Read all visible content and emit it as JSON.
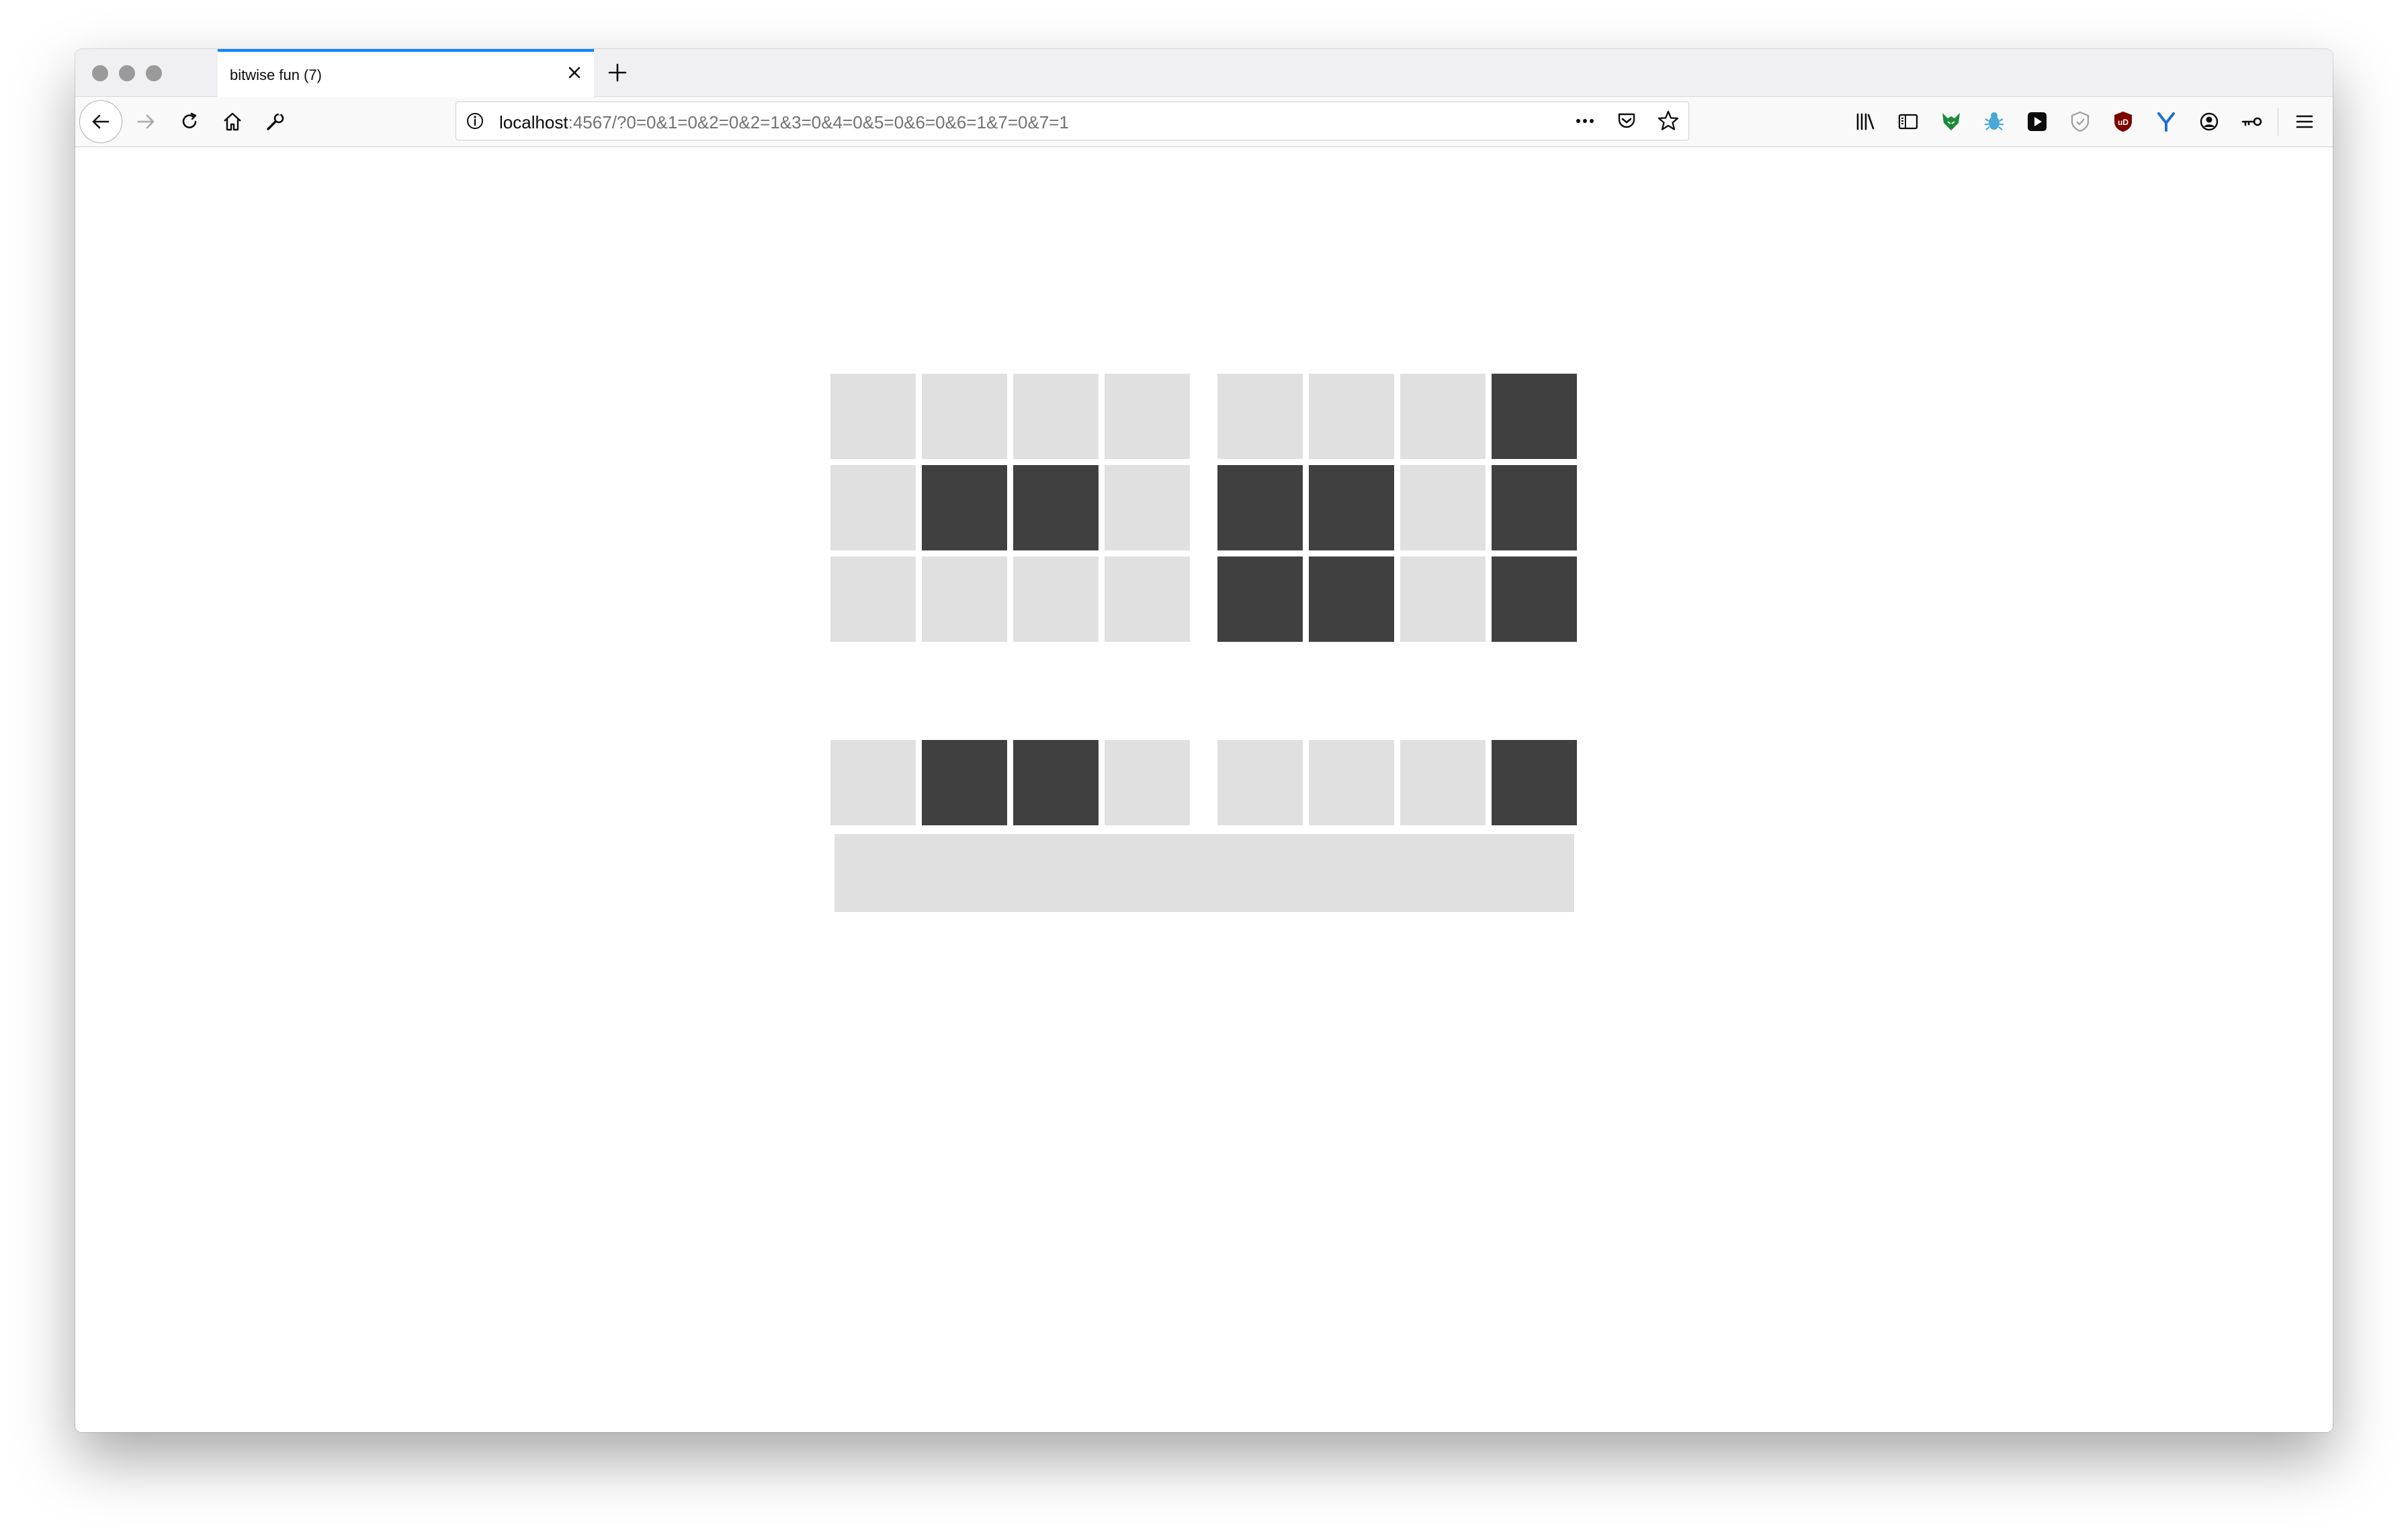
{
  "browser": {
    "tab_title": "bitwise fun (7)",
    "url_host": "localhost",
    "url_rest": ":4567/?0=0&1=0&2=0&2=1&3=0&4=0&5=0&6=0&6=1&7=0&7=1"
  },
  "colors": {
    "bit_on": "#404040",
    "bit_off": "#e0e0e0",
    "tab_accent": "#0a84ff"
  },
  "grid": {
    "rows": [
      [
        0,
        0,
        0,
        0,
        0,
        0,
        0,
        1
      ],
      [
        0,
        1,
        1,
        0,
        1,
        1,
        0,
        1
      ],
      [
        0,
        0,
        0,
        0,
        1,
        1,
        0,
        1
      ]
    ],
    "result": [
      0,
      1,
      1,
      0,
      0,
      0,
      0,
      1
    ]
  }
}
